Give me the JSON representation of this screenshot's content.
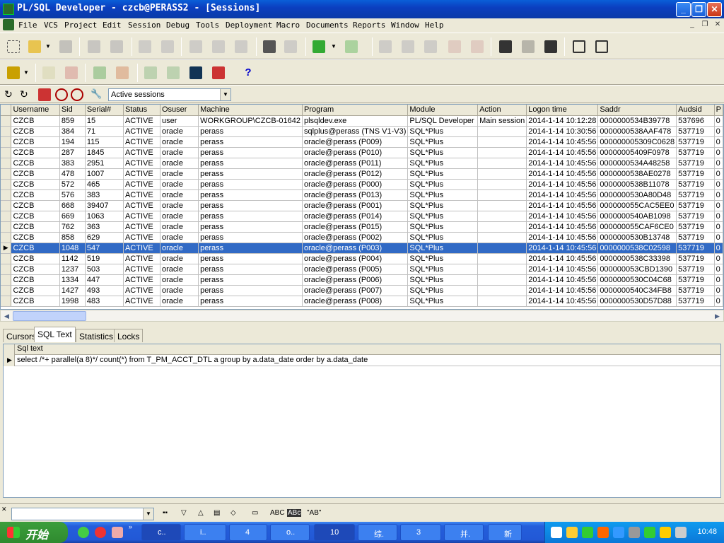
{
  "window": {
    "title": "PL/SQL Developer - czcb@PERASS2 - [Sessions]",
    "min_label": "_",
    "max_label": "❐",
    "close_label": "✕"
  },
  "menu": [
    "File",
    "VCS",
    "Project",
    "Edit",
    "Session",
    "Debug",
    "Tools",
    "Deployment",
    "Macro",
    "Documents",
    "Reports",
    "Window",
    "Help"
  ],
  "toolbar": {
    "filter_selected": "Active sessions"
  },
  "grid": {
    "columns": [
      "Username",
      "Sid",
      "Serial#",
      "Status",
      "Osuser",
      "Machine",
      "Program",
      "Module",
      "Action",
      "Logon time",
      "Saddr",
      "Audsid",
      "P"
    ],
    "rows": [
      [
        "CZCB",
        "859",
        "15",
        "ACTIVE",
        "user",
        "WORKGROUP\\CZCB-01642",
        "plsqldev.exe",
        "PL/SQL Developer",
        "Main session",
        "2014-1-14 10:12:28",
        "0000000534B39778",
        "537696",
        "0"
      ],
      [
        "CZCB",
        "384",
        "71",
        "ACTIVE",
        "oracle",
        "perass",
        "sqlplus@perass (TNS V1-V3)",
        "SQL*Plus",
        "",
        "2014-1-14 10:30:56",
        "0000000538AAF478",
        "537719",
        "0"
      ],
      [
        "CZCB",
        "194",
        "115",
        "ACTIVE",
        "oracle",
        "perass",
        "oracle@perass (P009)",
        "SQL*Plus",
        "",
        "2014-1-14 10:45:56",
        "000000005309C0628",
        "537719",
        "0"
      ],
      [
        "CZCB",
        "287",
        "1845",
        "ACTIVE",
        "oracle",
        "perass",
        "oracle@perass (P010)",
        "SQL*Plus",
        "",
        "2014-1-14 10:45:56",
        "00000005409F0978",
        "537719",
        "0"
      ],
      [
        "CZCB",
        "383",
        "2951",
        "ACTIVE",
        "oracle",
        "perass",
        "oracle@perass (P011)",
        "SQL*Plus",
        "",
        "2014-1-14 10:45:56",
        "0000000534A48258",
        "537719",
        "0"
      ],
      [
        "CZCB",
        "478",
        "1007",
        "ACTIVE",
        "oracle",
        "perass",
        "oracle@perass (P012)",
        "SQL*Plus",
        "",
        "2014-1-14 10:45:56",
        "0000000538AE0278",
        "537719",
        "0"
      ],
      [
        "CZCB",
        "572",
        "465",
        "ACTIVE",
        "oracle",
        "perass",
        "oracle@perass (P000)",
        "SQL*Plus",
        "",
        "2014-1-14 10:45:56",
        "0000000538B11078",
        "537719",
        "0"
      ],
      [
        "CZCB",
        "576",
        "383",
        "ACTIVE",
        "oracle",
        "perass",
        "oracle@perass (P013)",
        "SQL*Plus",
        "",
        "2014-1-14 10:45:56",
        "0000000530A80D48",
        "537719",
        "0"
      ],
      [
        "CZCB",
        "668",
        "39407",
        "ACTIVE",
        "oracle",
        "perass",
        "oracle@perass (P001)",
        "SQL*Plus",
        "",
        "2014-1-14 10:45:56",
        "000000055CAC5EE0",
        "537719",
        "0"
      ],
      [
        "CZCB",
        "669",
        "1063",
        "ACTIVE",
        "oracle",
        "perass",
        "oracle@perass (P014)",
        "SQL*Plus",
        "",
        "2014-1-14 10:45:56",
        "0000000540AB1098",
        "537719",
        "0"
      ],
      [
        "CZCB",
        "762",
        "363",
        "ACTIVE",
        "oracle",
        "perass",
        "oracle@perass (P015)",
        "SQL*Plus",
        "",
        "2014-1-14 10:45:56",
        "000000055CAF6CE0",
        "537719",
        "0"
      ],
      [
        "CZCB",
        "858",
        "629",
        "ACTIVE",
        "oracle",
        "perass",
        "oracle@perass (P002)",
        "SQL*Plus",
        "",
        "2014-1-14 10:45:56",
        "0000000530B13748",
        "537719",
        "0"
      ],
      [
        "CZCB",
        "1048",
        "547",
        "ACTIVE",
        "oracle",
        "perass",
        "oracle@perass (P003)",
        "SQL*Plus",
        "",
        "2014-1-14 10:45:56",
        "0000000538C02598",
        "537719",
        "0"
      ],
      [
        "CZCB",
        "1142",
        "519",
        "ACTIVE",
        "oracle",
        "perass",
        "oracle@perass (P004)",
        "SQL*Plus",
        "",
        "2014-1-14 10:45:56",
        "0000000538C33398",
        "537719",
        "0"
      ],
      [
        "CZCB",
        "1237",
        "503",
        "ACTIVE",
        "oracle",
        "perass",
        "oracle@perass (P005)",
        "SQL*Plus",
        "",
        "2014-1-14 10:45:56",
        "000000053CBD1390",
        "537719",
        "0"
      ],
      [
        "CZCB",
        "1334",
        "447",
        "ACTIVE",
        "oracle",
        "perass",
        "oracle@perass (P006)",
        "SQL*Plus",
        "",
        "2014-1-14 10:45:56",
        "0000000530C04C68",
        "537719",
        "0"
      ],
      [
        "CZCB",
        "1427",
        "493",
        "ACTIVE",
        "oracle",
        "perass",
        "oracle@perass (P007)",
        "SQL*Plus",
        "",
        "2014-1-14 10:45:56",
        "0000000540C34FB8",
        "537719",
        "0"
      ],
      [
        "CZCB",
        "1998",
        "483",
        "ACTIVE",
        "oracle",
        "perass",
        "oracle@perass (P008)",
        "SQL*Plus",
        "",
        "2014-1-14 10:45:56",
        "0000000530D57D88",
        "537719",
        "0"
      ]
    ],
    "selected_row": 12
  },
  "tabs": [
    "Cursors",
    "SQL Text",
    "Statistics",
    "Locks"
  ],
  "active_tab": 1,
  "sql": {
    "header": "Sql text",
    "text": "select /*+ parallel(a 8)*/ count(*) from T_PM_ACCT_DTL a group by a.data_date order by a.data_date"
  },
  "findbar": {
    "labels": [
      "ABC",
      "ABc",
      "\"AB\""
    ]
  },
  "taskbar": {
    "start_label": "开始",
    "tasks": [
      "c..",
      "i..",
      "4",
      "o..",
      "10",
      "综.",
      "3",
      "并.",
      "新"
    ],
    "clock": "10:48"
  },
  "colors": {
    "selection": "#316ac5",
    "titlebar": "#0b3fc0",
    "taskbar": "#245edb"
  }
}
